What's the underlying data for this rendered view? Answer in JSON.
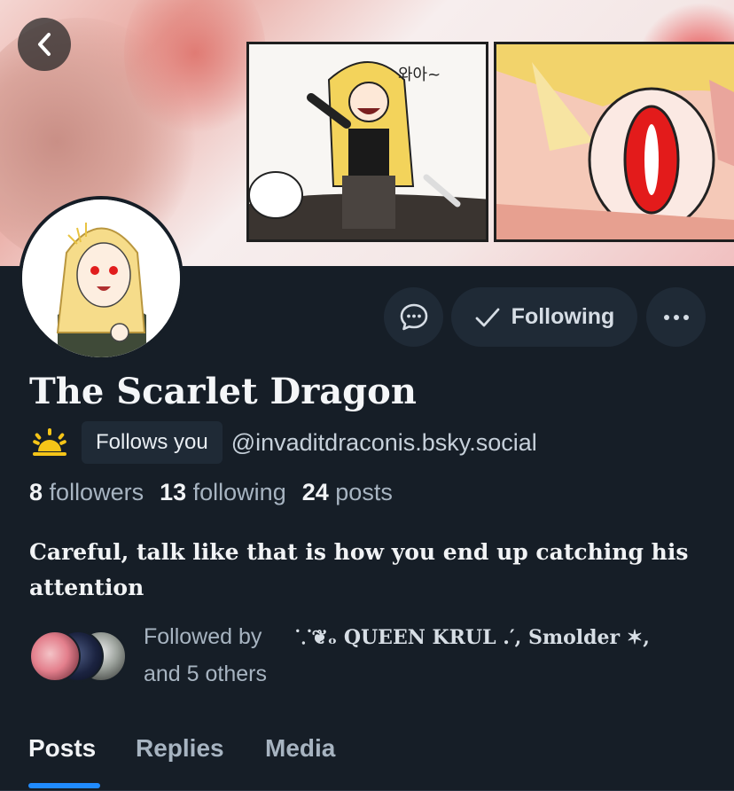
{
  "profile": {
    "display_name": "The Scarlet Dragon",
    "follows_you_label": "Follows you",
    "handle": "@invaditdraconis.bsky.social",
    "bio": "Careful, talk like that is how you end up catching his attention"
  },
  "actions": {
    "following_label": "Following"
  },
  "stats": {
    "followers_count": "8",
    "followers_label": "followers",
    "following_count": "13",
    "following_label": "following",
    "posts_count": "24",
    "posts_label": "posts"
  },
  "followed_by": {
    "prefix": "Followed by",
    "names": "⸪❦ₒ QUEEN KRUL .′, Smolder ✶,",
    "suffix": "and 5 others"
  },
  "tabs": [
    {
      "label": "Posts",
      "active": true
    },
    {
      "label": "Replies",
      "active": false
    },
    {
      "label": "Media",
      "active": false
    }
  ],
  "colors": {
    "background": "#161e27",
    "button_bg": "#1f2a36",
    "accent": "#208bfe",
    "muted_text": "#a7b4c1"
  }
}
